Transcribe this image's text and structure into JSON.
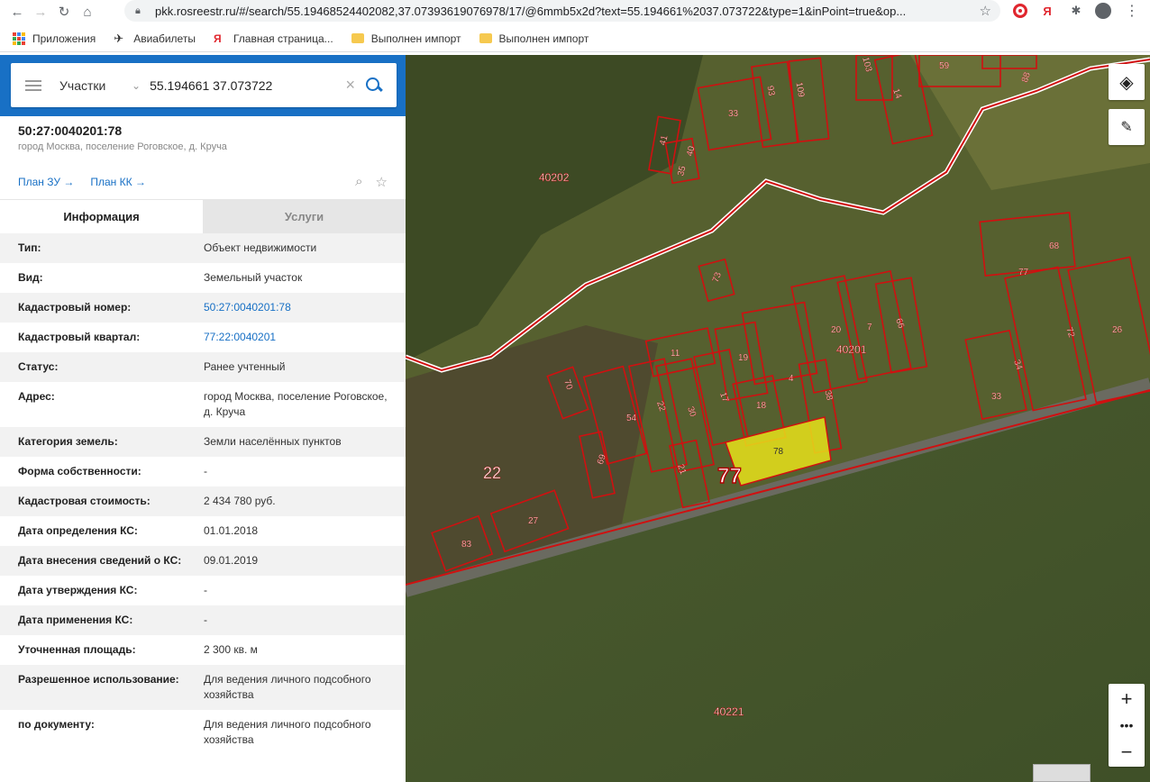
{
  "browser": {
    "url": "pkk.rosreestr.ru/#/search/55.19468524402082,37.07393619076978/17/@6mmb5x2d?text=55.194661%2037.073722&type=1&inPoint=true&op...",
    "bookmarks": [
      {
        "label": "Приложения",
        "icon": "apps-grid-icon"
      },
      {
        "label": "Авиабилеты",
        "icon": "plane-icon"
      },
      {
        "label": "Главная страница...",
        "icon": "yandex-icon"
      },
      {
        "label": "Выполнен импорт",
        "icon": "folder-icon"
      },
      {
        "label": "Выполнен импорт",
        "icon": "folder-icon"
      }
    ]
  },
  "search": {
    "layer": "Участки",
    "query": "55.194661 37.073722"
  },
  "object": {
    "cadastral_number": "50:27:0040201:78",
    "address_short": "город Москва, поселение Роговское, д. Круча",
    "link_plan_zu": "План ЗУ →",
    "link_plan_kk": "План КК →"
  },
  "tabs": {
    "info": "Информация",
    "services": "Услуги"
  },
  "rows": [
    {
      "label": "Тип:",
      "value": "Объект недвижимости"
    },
    {
      "label": "Вид:",
      "value": "Земельный участок"
    },
    {
      "label": "Кадастровый номер:",
      "value": "50:27:0040201:78"
    },
    {
      "label": "Кадастровый квартал:",
      "value": "77:22:0040201"
    },
    {
      "label": "Статус:",
      "value": "Ранее учтенный"
    },
    {
      "label": "Адрес:",
      "value": "город Москва, поселение Роговское, д. Круча"
    },
    {
      "label": "Категория земель:",
      "value": "Земли населённых пунктов"
    },
    {
      "label": "Форма собственности:",
      "value": "-"
    },
    {
      "label": "Кадастровая стоимость:",
      "value": "2 434 780 руб."
    },
    {
      "label": "Дата определения КС:",
      "value": "01.01.2018"
    },
    {
      "label": "Дата внесения сведений о КС:",
      "value": "09.01.2019"
    },
    {
      "label": "Дата утверждения КС:",
      "value": "-"
    },
    {
      "label": "Дата применения КС:",
      "value": "-"
    },
    {
      "label": "Уточненная площадь:",
      "value": "2 300 кв. м"
    },
    {
      "label": "Разрешенное использование:",
      "value": "Для ведения личного подсобного хозяйства"
    },
    {
      "label": "по документу:",
      "value": "Для ведения личного подсобного хозяйства"
    }
  ],
  "map": {
    "labels": {
      "q40202": "40202",
      "q40201": "40201",
      "q40221": "40221",
      "region22": "22",
      "region77": "77",
      "selected": "78"
    },
    "parcel_numbers": [
      "59",
      "93",
      "109",
      "103",
      "14",
      "88",
      "33",
      "41",
      "40",
      "35",
      "68",
      "77",
      "73",
      "20",
      "7",
      "66",
      "72",
      "26",
      "11",
      "19",
      "4",
      "38",
      "33",
      "34",
      "70",
      "54",
      "22",
      "30",
      "17",
      "18",
      "69",
      "21",
      "27",
      "83",
      "33"
    ]
  },
  "colors": {
    "accent": "#1870c5",
    "parcel_border": "#d01010",
    "selected_fill": "#e8e21a"
  }
}
